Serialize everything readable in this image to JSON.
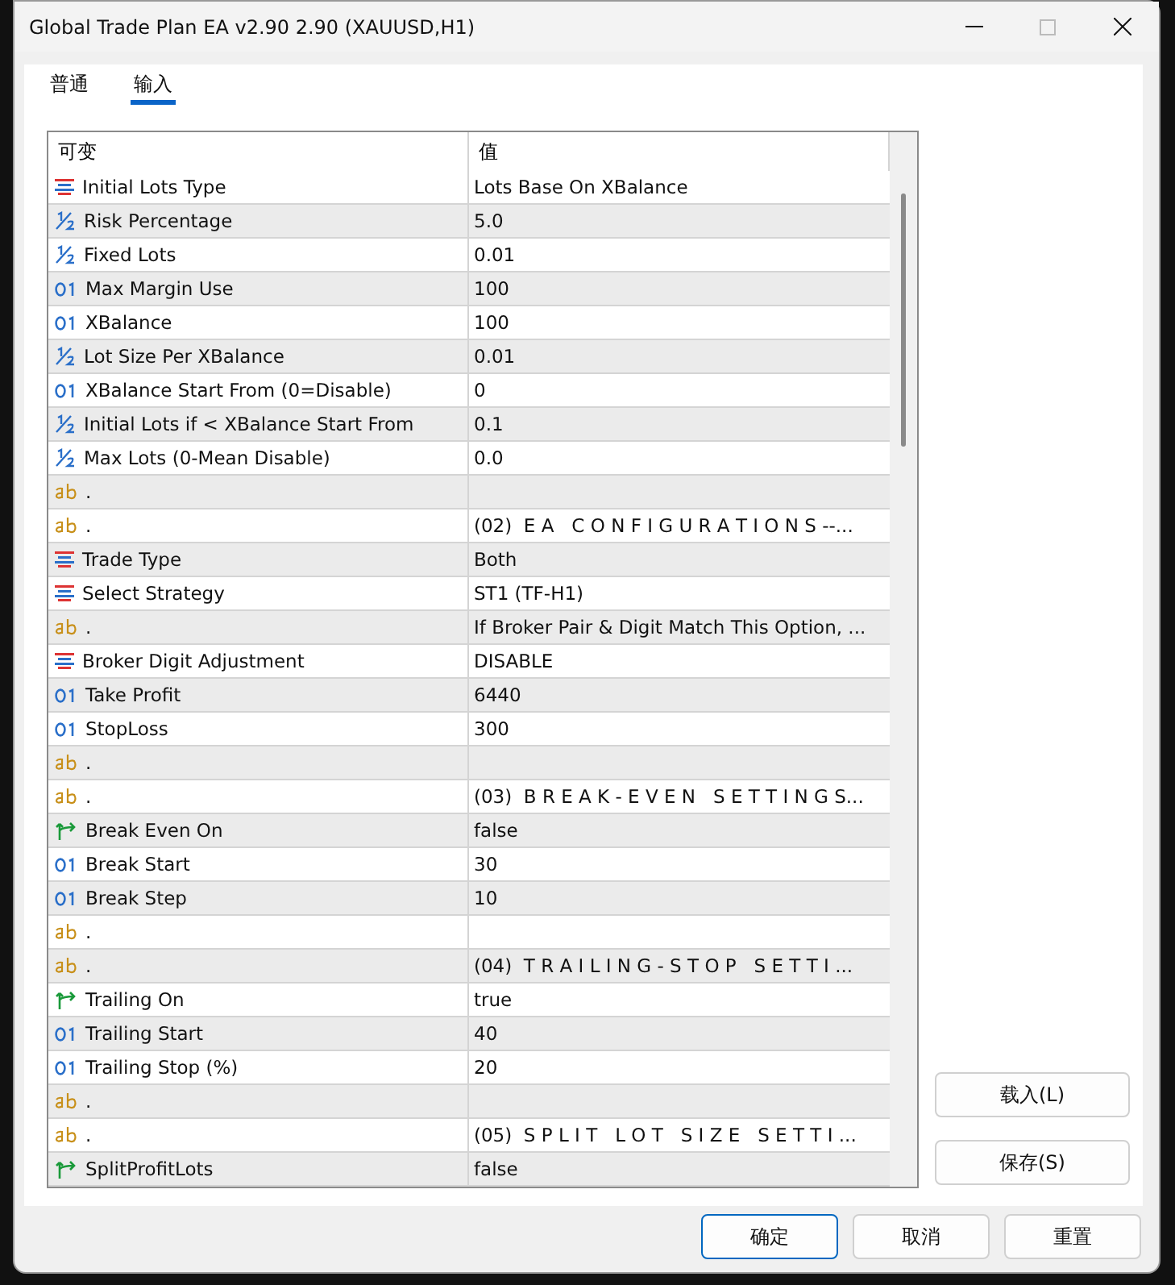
{
  "window": {
    "title": "Global Trade Plan EA v2.90 2.90 (XAUUSD,H1)"
  },
  "tabs": [
    {
      "label": "普通",
      "selected": false
    },
    {
      "label": "输入",
      "selected": true
    }
  ],
  "table": {
    "columns": [
      "可变",
      "值"
    ],
    "rows": [
      {
        "kind": "enum",
        "name": "Initial Lots Type",
        "value": "Lots Base On XBalance"
      },
      {
        "kind": "double",
        "name": "Risk Percentage",
        "value": "5.0"
      },
      {
        "kind": "double",
        "name": "Fixed Lots",
        "value": "0.01"
      },
      {
        "kind": "int",
        "name": "Max Margin Use",
        "value": "100"
      },
      {
        "kind": "int",
        "name": "XBalance",
        "value": "100"
      },
      {
        "kind": "double",
        "name": "Lot Size Per XBalance",
        "value": "0.01"
      },
      {
        "kind": "int",
        "name": "XBalance Start From (0=Disable)",
        "value": "0"
      },
      {
        "kind": "double",
        "name": "Initial Lots if < XBalance Start From",
        "value": "0.1"
      },
      {
        "kind": "double",
        "name": "Max Lots (0-Mean Disable)",
        "value": "0.0"
      },
      {
        "kind": "string",
        "name": "."
      },
      {
        "kind": "string",
        "name": ".",
        "value": "(02)  E A   C O N F I G U R A T I O N S --..."
      },
      {
        "kind": "enum",
        "name": "Trade Type",
        "value": "Both"
      },
      {
        "kind": "enum",
        "name": "Select Strategy",
        "value": "ST1 (TF-H1)"
      },
      {
        "kind": "string",
        "name": ".",
        "value": "If Broker Pair & Digit Match This Option, ..."
      },
      {
        "kind": "enum",
        "name": "Broker Digit Adjustment",
        "value": "DISABLE"
      },
      {
        "kind": "int",
        "name": "Take Profit",
        "value": "6440"
      },
      {
        "kind": "int",
        "name": "StopLoss",
        "value": "300"
      },
      {
        "kind": "string",
        "name": "."
      },
      {
        "kind": "string",
        "name": ".",
        "value": "(03)  B R E A K - E V E N   S E T T I N G S..."
      },
      {
        "kind": "bool",
        "name": "Break Even On",
        "value": "false"
      },
      {
        "kind": "int",
        "name": "Break Start",
        "value": "30"
      },
      {
        "kind": "int",
        "name": "Break Step",
        "value": "10"
      },
      {
        "kind": "string",
        "name": "."
      },
      {
        "kind": "string",
        "name": ".",
        "value": "(04)  T R A I L I N G - S T O P   S E T T I ..."
      },
      {
        "kind": "bool",
        "name": "Trailing On",
        "value": "true"
      },
      {
        "kind": "int",
        "name": "Trailing Start",
        "value": "40"
      },
      {
        "kind": "int",
        "name": "Trailing Stop (%)",
        "value": "20"
      },
      {
        "kind": "string",
        "name": "."
      },
      {
        "kind": "string",
        "name": ".",
        "value": "(05)  S P L I T   L O T   S I Z E   S E T T I ..."
      },
      {
        "kind": "bool",
        "name": "SplitProfitLots",
        "value": "false"
      }
    ]
  },
  "side_buttons": [
    "载入(L)",
    "保存(S)"
  ],
  "footer_buttons": [
    {
      "label": "确定",
      "focused": true
    },
    {
      "label": "取消",
      "focused": false
    },
    {
      "label": "重置",
      "focused": false
    }
  ]
}
